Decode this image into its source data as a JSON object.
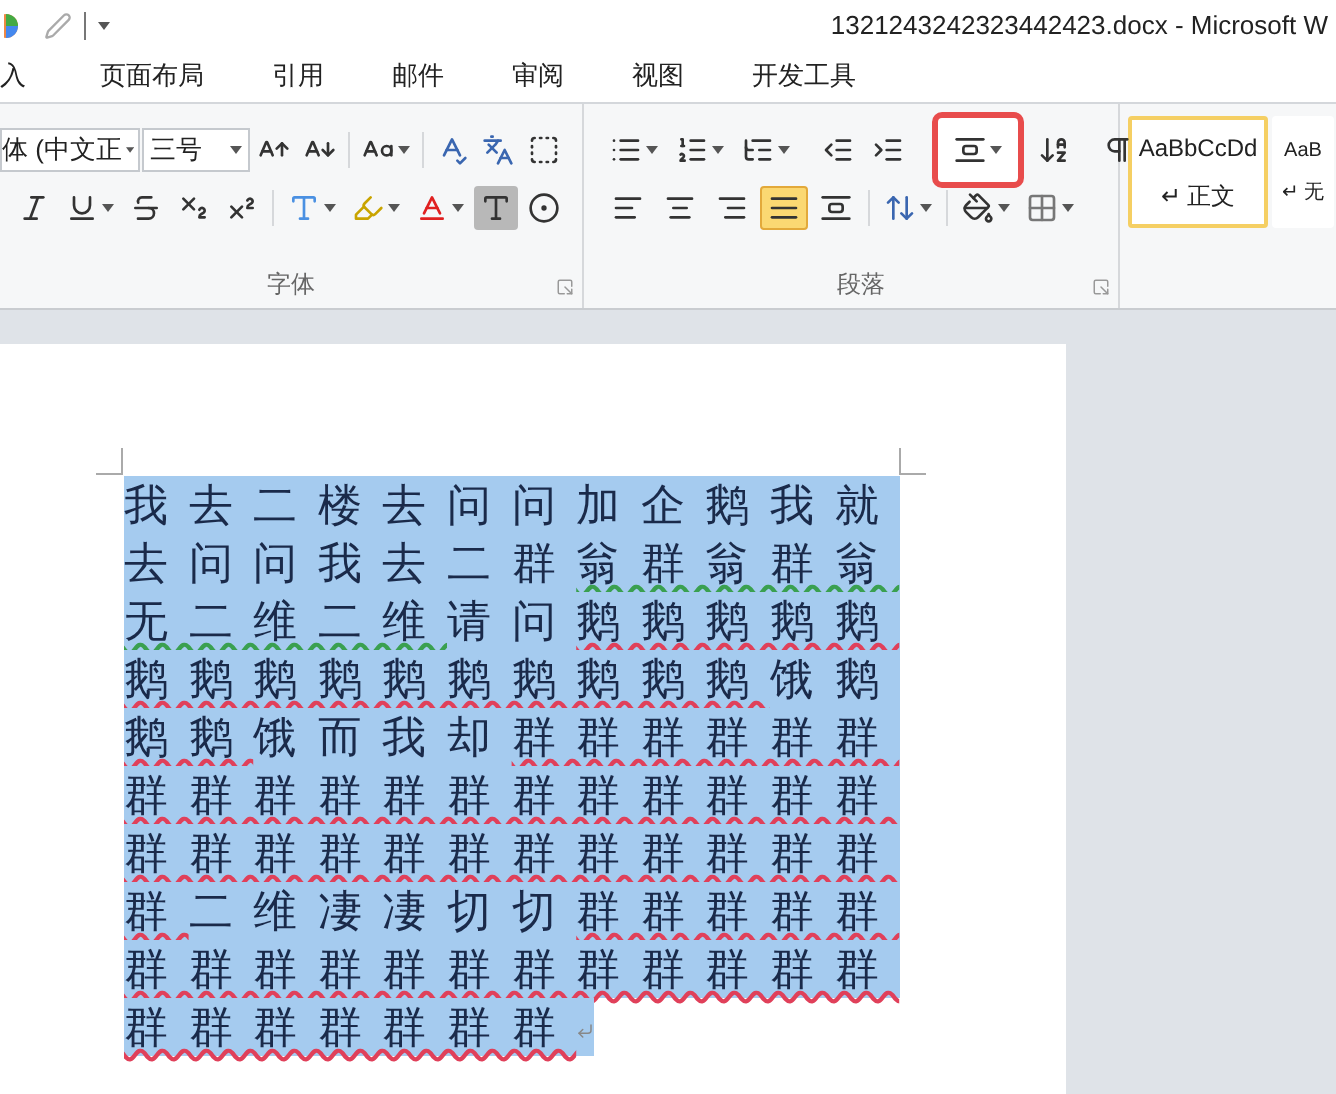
{
  "window": {
    "title": "1321243242323442423.docx - Microsoft W"
  },
  "tabs": [
    {
      "label": "入",
      "selected": false
    },
    {
      "label": "页面布局",
      "selected": false
    },
    {
      "label": "引用",
      "selected": false
    },
    {
      "label": "邮件",
      "selected": false
    },
    {
      "label": "审阅",
      "selected": false
    },
    {
      "label": "视图",
      "selected": false
    },
    {
      "label": "开发工具",
      "selected": false
    }
  ],
  "font_group": {
    "label": "字体",
    "font_name": "体 (中文正",
    "font_size": "三号"
  },
  "paragraph_group": {
    "label": "段落",
    "top_buttons": [
      {
        "kind": "bullets",
        "highlighted": false
      },
      {
        "kind": "numbering",
        "highlighted": false
      },
      {
        "kind": "multilevel",
        "highlighted": false
      },
      {
        "kind": "indent-decrease",
        "highlighted": false
      },
      {
        "kind": "indent-increase",
        "highlighted": false
      },
      {
        "kind": "text-direction",
        "highlighted": true
      },
      {
        "kind": "sort",
        "highlighted": false
      },
      {
        "kind": "marks",
        "highlighted": false
      }
    ],
    "alignment": [
      {
        "kind": "left",
        "selected": false
      },
      {
        "kind": "center",
        "selected": false
      },
      {
        "kind": "right",
        "selected": false
      },
      {
        "kind": "justify",
        "selected": true
      },
      {
        "kind": "distributed",
        "selected": false
      }
    ]
  },
  "styles": [
    {
      "preview": "AaBbCcDd",
      "name": "↵ 正文",
      "selected": true
    },
    {
      "preview": "AaB",
      "name": "↵ 无",
      "selected": false
    }
  ],
  "document": {
    "lines": [
      [
        {
          "text": "我去二楼去问问加企鹅我就",
          "spelling_error": false,
          "grammar_error": false
        }
      ],
      [
        {
          "text": "去问问我去二群",
          "spelling_error": false,
          "grammar_error": false
        },
        {
          "text": "翁群翁群翁",
          "spelling_error": false,
          "grammar_error": true
        }
      ],
      [
        {
          "text": "无二维二维",
          "spelling_error": false,
          "grammar_error": true
        },
        {
          "text": "请问",
          "spelling_error": false,
          "grammar_error": false
        },
        {
          "text": "鹅鹅鹅鹅鹅",
          "spelling_error": true,
          "grammar_error": false
        }
      ],
      [
        {
          "text": "鹅鹅鹅鹅鹅鹅鹅鹅鹅鹅",
          "spelling_error": true,
          "grammar_error": false
        },
        {
          "text": "饿鹅",
          "spelling_error": false,
          "grammar_error": false
        }
      ],
      [
        {
          "text": "鹅鹅",
          "spelling_error": true,
          "grammar_error": false
        },
        {
          "text": "饿而我却",
          "spelling_error": false,
          "grammar_error": false
        },
        {
          "text": "群群群群群群",
          "spelling_error": true,
          "grammar_error": false
        }
      ],
      [
        {
          "text": "群群群群群群群群群群群群",
          "spelling_error": true,
          "grammar_error": false
        }
      ],
      [
        {
          "text": "群群群群群群群群群群群群",
          "spelling_error": true,
          "grammar_error": false
        }
      ],
      [
        {
          "text": "群",
          "spelling_error": true,
          "grammar_error": false
        },
        {
          "text": "二维凄凄切切",
          "spelling_error": false,
          "grammar_error": false
        },
        {
          "text": "群群群群群",
          "spelling_error": true,
          "grammar_error": false
        }
      ],
      [
        {
          "text": "群群群群群群群群群群群群",
          "spelling_error": true,
          "grammar_error": false
        }
      ],
      [
        {
          "text": "群群群群群群群",
          "spelling_error": true,
          "grammar_error": false
        }
      ]
    ]
  }
}
